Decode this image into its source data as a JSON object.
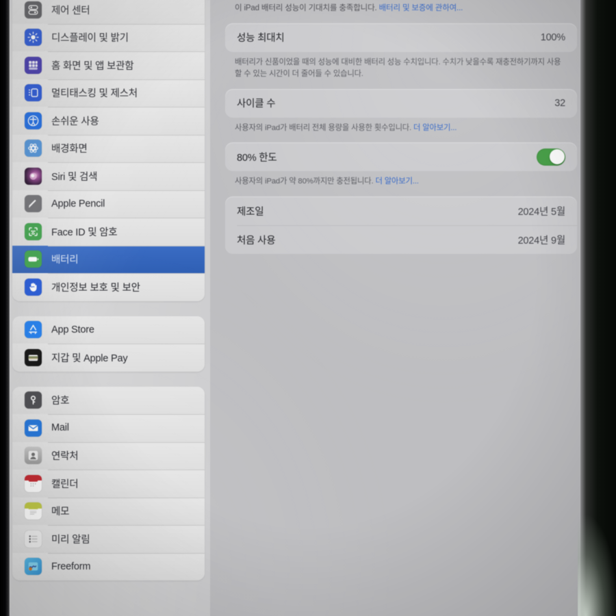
{
  "device": {
    "platform": "iPadOS Settings",
    "selected_section": "배터리"
  },
  "colors": {
    "selection_blue": "#3a6cc4",
    "link_blue": "#2a5fc4",
    "toggle_green": "#3f9b3f",
    "panel_bg": "#bebec1",
    "card_bg": "#cacacd",
    "sidebar_bg": "#d4d4d5"
  },
  "sidebar": {
    "groups": [
      {
        "name": "settings-group-primary",
        "items": [
          {
            "label": "제어 센터",
            "icon": "control-center-icon",
            "icon_class": "ic-control",
            "selected": false
          },
          {
            "label": "디스플레이 및 밝기",
            "icon": "display-brightness-icon",
            "icon_class": "ic-display",
            "selected": false
          },
          {
            "label": "홈 화면 및 앱 보관함",
            "icon": "home-screen-icon",
            "icon_class": "ic-home",
            "selected": false
          },
          {
            "label": "멀티태스킹 및 제스처",
            "icon": "multitasking-icon",
            "icon_class": "ic-multi",
            "selected": false
          },
          {
            "label": "손쉬운 사용",
            "icon": "accessibility-icon",
            "icon_class": "ic-access",
            "selected": false
          },
          {
            "label": "배경화면",
            "icon": "wallpaper-icon",
            "icon_class": "ic-wallpaper",
            "selected": false
          },
          {
            "label": "Siri 및 검색",
            "icon": "siri-icon",
            "icon_class": "ic-siri",
            "selected": false
          },
          {
            "label": "Apple Pencil",
            "icon": "apple-pencil-icon",
            "icon_class": "ic-pencil",
            "selected": false
          },
          {
            "label": "Face ID 및 암호",
            "icon": "face-id-icon",
            "icon_class": "ic-faceid",
            "selected": false
          },
          {
            "label": "배터리",
            "icon": "battery-icon",
            "icon_class": "ic-battery",
            "selected": true
          },
          {
            "label": "개인정보 보호 및 보안",
            "icon": "privacy-hand-icon",
            "icon_class": "ic-privacy",
            "selected": false
          }
        ]
      },
      {
        "name": "settings-group-store",
        "items": [
          {
            "label": "App Store",
            "icon": "app-store-icon",
            "icon_class": "ic-appstore",
            "selected": false
          },
          {
            "label": "지갑 및 Apple Pay",
            "icon": "wallet-icon",
            "icon_class": "ic-wallet",
            "selected": false
          }
        ]
      },
      {
        "name": "settings-group-apps",
        "items": [
          {
            "label": "암호",
            "icon": "passwords-key-icon",
            "icon_class": "ic-passwords",
            "selected": false
          },
          {
            "label": "Mail",
            "icon": "mail-icon",
            "icon_class": "ic-mail",
            "selected": false
          },
          {
            "label": "연락처",
            "icon": "contacts-icon",
            "icon_class": "ic-contacts",
            "selected": false
          },
          {
            "label": "캘린더",
            "icon": "calendar-icon",
            "icon_class": "ic-calendar",
            "selected": false
          },
          {
            "label": "메모",
            "icon": "notes-icon",
            "icon_class": "ic-notes",
            "selected": false
          },
          {
            "label": "미리 알림",
            "icon": "reminders-icon",
            "icon_class": "ic-reminders",
            "selected": false
          },
          {
            "label": "Freeform",
            "icon": "freeform-icon",
            "icon_class": "ic-freeform",
            "selected": false
          }
        ]
      }
    ]
  },
  "main": {
    "header_blurb": "이 iPad 배터리 성능이 기대치를 충족합니다. 배터리 및 보증에 관하여...",
    "header_blurb_plain": "이 iPad 배터리 성능이 기대치를 충족합니다. ",
    "header_blurb_link": "배터리 및 보증에 관하여...",
    "card_health": {
      "row_capacity": {
        "title": "성능 최대치",
        "value": "100%"
      }
    },
    "note_capacity": "배터리가 신품이었을 때의 성능에 대비한 배터리 성능 수치입니다. 수치가 낮을수록 재충전하기까지 사용할 수 있는 시간이 더 줄어들 수 있습니다.",
    "card_cycles": {
      "row_cycles": {
        "title": "사이클 수",
        "value": "32"
      }
    },
    "note_cycles_plain": "사용자의 iPad가 배터리 전체 용량을 사용한 횟수입니다. ",
    "note_cycles_link": "더 알아보기...",
    "card_limit": {
      "row_limit": {
        "title": "80% 한도",
        "toggle_state": "on"
      }
    },
    "note_limit_plain": "사용자의 iPad가 약 80%까지만 충전됩니다. ",
    "note_limit_link": "더 알아보기...",
    "card_dates": {
      "rows": [
        {
          "title": "제조일",
          "value": "2024년 5월"
        },
        {
          "title": "처음 사용",
          "value": "2024년 9월"
        }
      ]
    }
  }
}
